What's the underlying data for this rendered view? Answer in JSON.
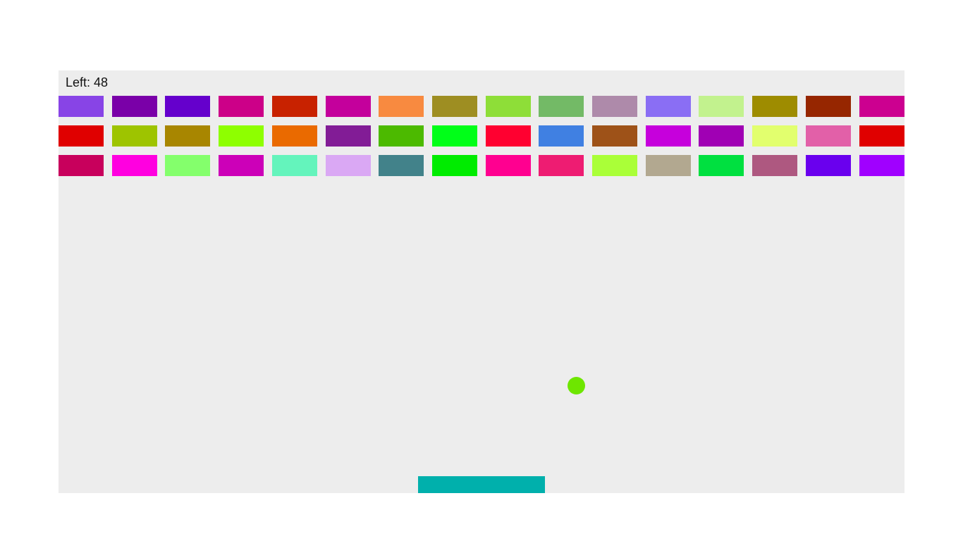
{
  "hud": {
    "left_label": "Left:",
    "left_value": "48"
  },
  "bricks": {
    "rows": [
      [
        "#8844e6",
        "#7a00a8",
        "#6500cc",
        "#cc0088",
        "#c82200",
        "#c4009c",
        "#f88a40",
        "#9e8e22",
        "#8ede38",
        "#73ba66",
        "#ae8aaa",
        "#8a6ef4",
        "#c2f28e",
        "#9e8c00",
        "#962600",
        "#cc0090"
      ],
      [
        "#e00000",
        "#9ec400",
        "#a88600",
        "#8eff00",
        "#ea6a00",
        "#821c96",
        "#4cba00",
        "#00ff18",
        "#ff0030",
        "#4080e2",
        "#9e5218",
        "#c600dc",
        "#a000b4",
        "#e2ff6e",
        "#e260a8",
        "#e00000"
      ],
      [
        "#c8005c",
        "#ff00e0",
        "#84ff6c",
        "#cc00b8",
        "#64f4bc",
        "#daa8f4",
        "#42828a",
        "#00ec00",
        "#ff0090",
        "#ee1c72",
        "#aaff38",
        "#b2a890",
        "#00e040",
        "#ae5880",
        "#6a00ee",
        "#a000ff"
      ]
    ]
  },
  "ball": {
    "color": "#6ee600"
  },
  "paddle": {
    "color": "#00b0ac"
  }
}
